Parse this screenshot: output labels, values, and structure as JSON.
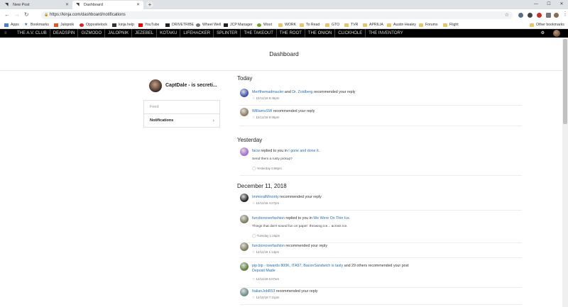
{
  "browser": {
    "tabs": [
      {
        "title": "New Post",
        "active": false
      },
      {
        "title": "Dashboard",
        "active": true
      }
    ],
    "url": "https://kinja.com/dashboard/notifications",
    "bookmarks": [
      {
        "label": "Apps",
        "icon": "apps-grid-icon"
      },
      {
        "label": "Bookmarks",
        "icon": "star-icon"
      },
      {
        "label": "Jalopnik",
        "icon": "jalopnik-icon"
      },
      {
        "label": "Oppositelock",
        "icon": "oppositelock-icon"
      },
      {
        "label": "kinja help",
        "icon": "kinja-icon"
      },
      {
        "label": "YouTube",
        "icon": "youtube-icon"
      },
      {
        "label": "DRIVETRIBE",
        "icon": "drivetribe-icon"
      },
      {
        "label": "Wheel Well",
        "icon": "wheel-icon"
      },
      {
        "label": "JCP Manager",
        "icon": "jcp-icon"
      },
      {
        "label": "Woot",
        "icon": "woot-icon"
      },
      {
        "label": "WORK",
        "icon": "folder-icon"
      },
      {
        "label": "To Read",
        "icon": "folder-icon"
      },
      {
        "label": "GTO",
        "icon": "folder-icon"
      },
      {
        "label": "TVR",
        "icon": "folder-icon"
      },
      {
        "label": "APRILIA",
        "icon": "folder-icon"
      },
      {
        "label": "Austin Healey",
        "icon": "folder-icon"
      },
      {
        "label": "Forums",
        "icon": "folder-icon"
      },
      {
        "label": "Flight",
        "icon": "folder-icon"
      }
    ],
    "other_bookmarks": "Other bookmarks"
  },
  "kinja_nav": {
    "sites": [
      "THE A.V. CLUB",
      "DEADSPIN",
      "GIZMODO",
      "JALOPNIK",
      "JEZEBEL",
      "KOTAKU",
      "LIFEHACKER",
      "SPLINTER",
      "THE TAKEOUT",
      "THE ROOT",
      "THE ONION",
      "CLICKHOLE",
      "THE INVENTORY"
    ]
  },
  "page": {
    "title": "Dashboard"
  },
  "profile": {
    "name": "CaptDale - is secreti..."
  },
  "menu": {
    "feed": "Feed",
    "notifications": "Notifications"
  },
  "sections": [
    {
      "heading": "Today",
      "items": [
        {
          "parts": [
            {
              "t": "Merfthemadmauler",
              "link": true
            },
            {
              "t": " and ",
              "link": false
            },
            {
              "t": "Dr. Zoidberg",
              "link": true
            },
            {
              "t": " recommended your reply",
              "link": false
            }
          ],
          "quote": "",
          "meta": "12/12/18 8:46pm",
          "meta_icon": "star",
          "avatar": "#3d4fa8"
        },
        {
          "parts": [
            {
              "t": "WilliamsSW",
              "link": true
            },
            {
              "t": " recommended your reply",
              "link": false
            }
          ],
          "quote": "",
          "meta": "12/12/18 8:05pm",
          "meta_icon": "star",
          "avatar": "#8c7a5e"
        }
      ]
    },
    {
      "heading": "Yesterday",
      "items": [
        {
          "parts": [
            {
              "t": "facw",
              "link": true
            },
            {
              "t": " replied to you in ",
              "link": false
            },
            {
              "t": "I gone and done it.",
              "link": true
            }
          ],
          "quote": "Send them a rusty pickup?",
          "meta": "Yesterday 6:58pm",
          "meta_icon": "bubble",
          "avatar": "#a46ad0"
        }
      ]
    },
    {
      "heading": "December 11, 2018",
      "items": [
        {
          "parts": [
            {
              "t": "ImmoralMinority",
              "link": true
            },
            {
              "t": " recommended your reply",
              "link": false
            }
          ],
          "quote": "",
          "meta": "12/11/18 4:27pm",
          "meta_icon": "star",
          "avatar": "#222222"
        },
        {
          "parts": [
            {
              "t": "functionoverfashion",
              "link": true
            },
            {
              "t": " replied to you in ",
              "link": false
            },
            {
              "t": "We Were On Thin Ice.",
              "link": true
            }
          ],
          "quote": "Things that don't sound fun on paper: throwing ice... across ice.",
          "meta": "Tuesday 1:15pm",
          "meta_icon": "bubble",
          "avatar": "#7a7a5a"
        },
        {
          "parts": [
            {
              "t": "functionoverfashion",
              "link": true
            },
            {
              "t": " recommended your reply",
              "link": false
            }
          ],
          "quote": "",
          "meta": "12/11/18 1:13pm",
          "meta_icon": "star",
          "avatar": "#7a7a5a"
        },
        {
          "parts": [
            {
              "t": "pip bip - towards 800K, ITA97, BaconSandwich is tasty",
              "link": true
            },
            {
              "t": " and 29 others recommended your post",
              "link": false
            }
          ],
          "quote": "",
          "link2": "Deposit Made",
          "meta": "12/11/18 6:07am",
          "meta_icon": "star",
          "avatar": "#5f7d3a"
        },
        {
          "parts": [
            {
              "t": "ItalianJobR53",
              "link": true
            },
            {
              "t": " recommended your reply",
              "link": false
            }
          ],
          "quote": "",
          "meta": "12/10/18 7:31pm",
          "meta_icon": "star",
          "avatar": "#6b8a8a"
        }
      ]
    }
  ]
}
